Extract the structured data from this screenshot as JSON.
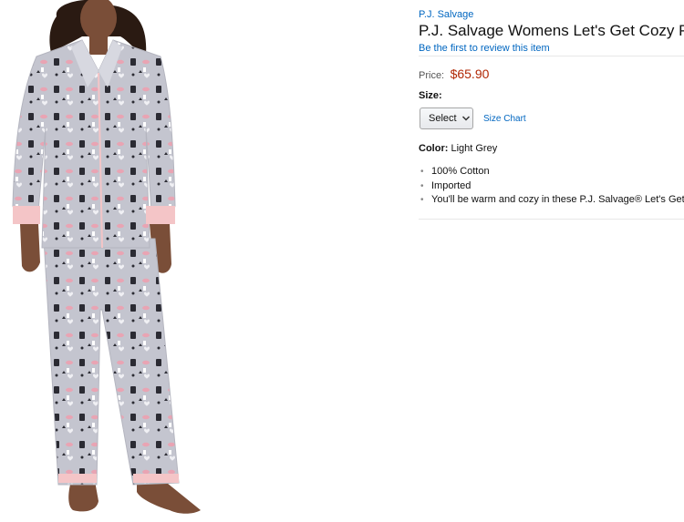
{
  "product": {
    "brand": "P.J. Salvage",
    "title": "P.J. Salvage Womens Let's Get Cozy PJ",
    "review_link": "Be the first to review this item",
    "price_label": "Price:",
    "price": "$65.90",
    "size_label": "Size:",
    "size_selected": "Select",
    "size_chart": "Size Chart",
    "color_label": "Color:",
    "color_value": "Light Grey",
    "features": [
      "100% Cotton",
      "Imported",
      "You'll be warm and cozy in these P.J. Salvage® Let's Get Co"
    ]
  },
  "image": {
    "alt": "model-wearing-grey-printed-pajama-set",
    "colors": {
      "fabric": "#c4c5cf",
      "cuff": "#f4c5c7",
      "skin": "#7a4e38",
      "hair": "#2a1a12",
      "print": "#2b2b33"
    }
  },
  "colors": {
    "link": "#0066c0",
    "price": "#b12704",
    "divider": "#e7e7e7"
  }
}
